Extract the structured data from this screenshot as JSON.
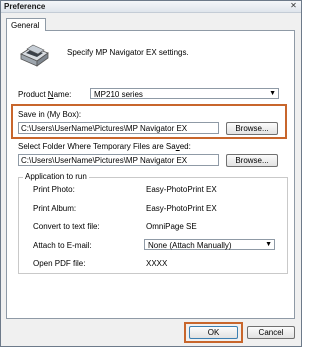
{
  "window": {
    "title": "Preference",
    "close_glyph": "✕"
  },
  "tabs": [
    {
      "label": "General"
    }
  ],
  "header": {
    "text": "Specify MP Navigator EX settings."
  },
  "product": {
    "label_pre": "Product ",
    "label_u": "N",
    "label_post": "ame:",
    "value": "MP210 series"
  },
  "save_in": {
    "label": "Save in (My Box):",
    "path": "C:\\Users\\UserName\\Pictures\\MP Navigator EX",
    "browse_label": "Browse..."
  },
  "temp": {
    "label_pre": "Select Folder Where Temporary Files are Sa",
    "label_u": "v",
    "label_post": "ed:",
    "path": "C:\\Users\\UserName\\Pictures\\MP Navigator EX",
    "browse_label": "Browse..."
  },
  "app_group": {
    "title": "Application to run",
    "rows": [
      {
        "label": "Print Photo:",
        "value": "Easy-PhotoPrint EX"
      },
      {
        "label": "Print Album:",
        "value": "Easy-PhotoPrint EX"
      },
      {
        "label": "Convert to text file:",
        "value": "OmniPage SE"
      },
      {
        "label": "Attach to E-mail:",
        "value": "None (Attach Manually)"
      },
      {
        "label": "Open PDF file:",
        "value": "XXXX"
      }
    ]
  },
  "footer": {
    "ok_label": "OK",
    "cancel_label": "Cancel"
  },
  "colors": {
    "highlight": "#c8662c"
  },
  "icons": {
    "scanner": "scanner-icon",
    "dropdown": "chevron-down-icon"
  }
}
